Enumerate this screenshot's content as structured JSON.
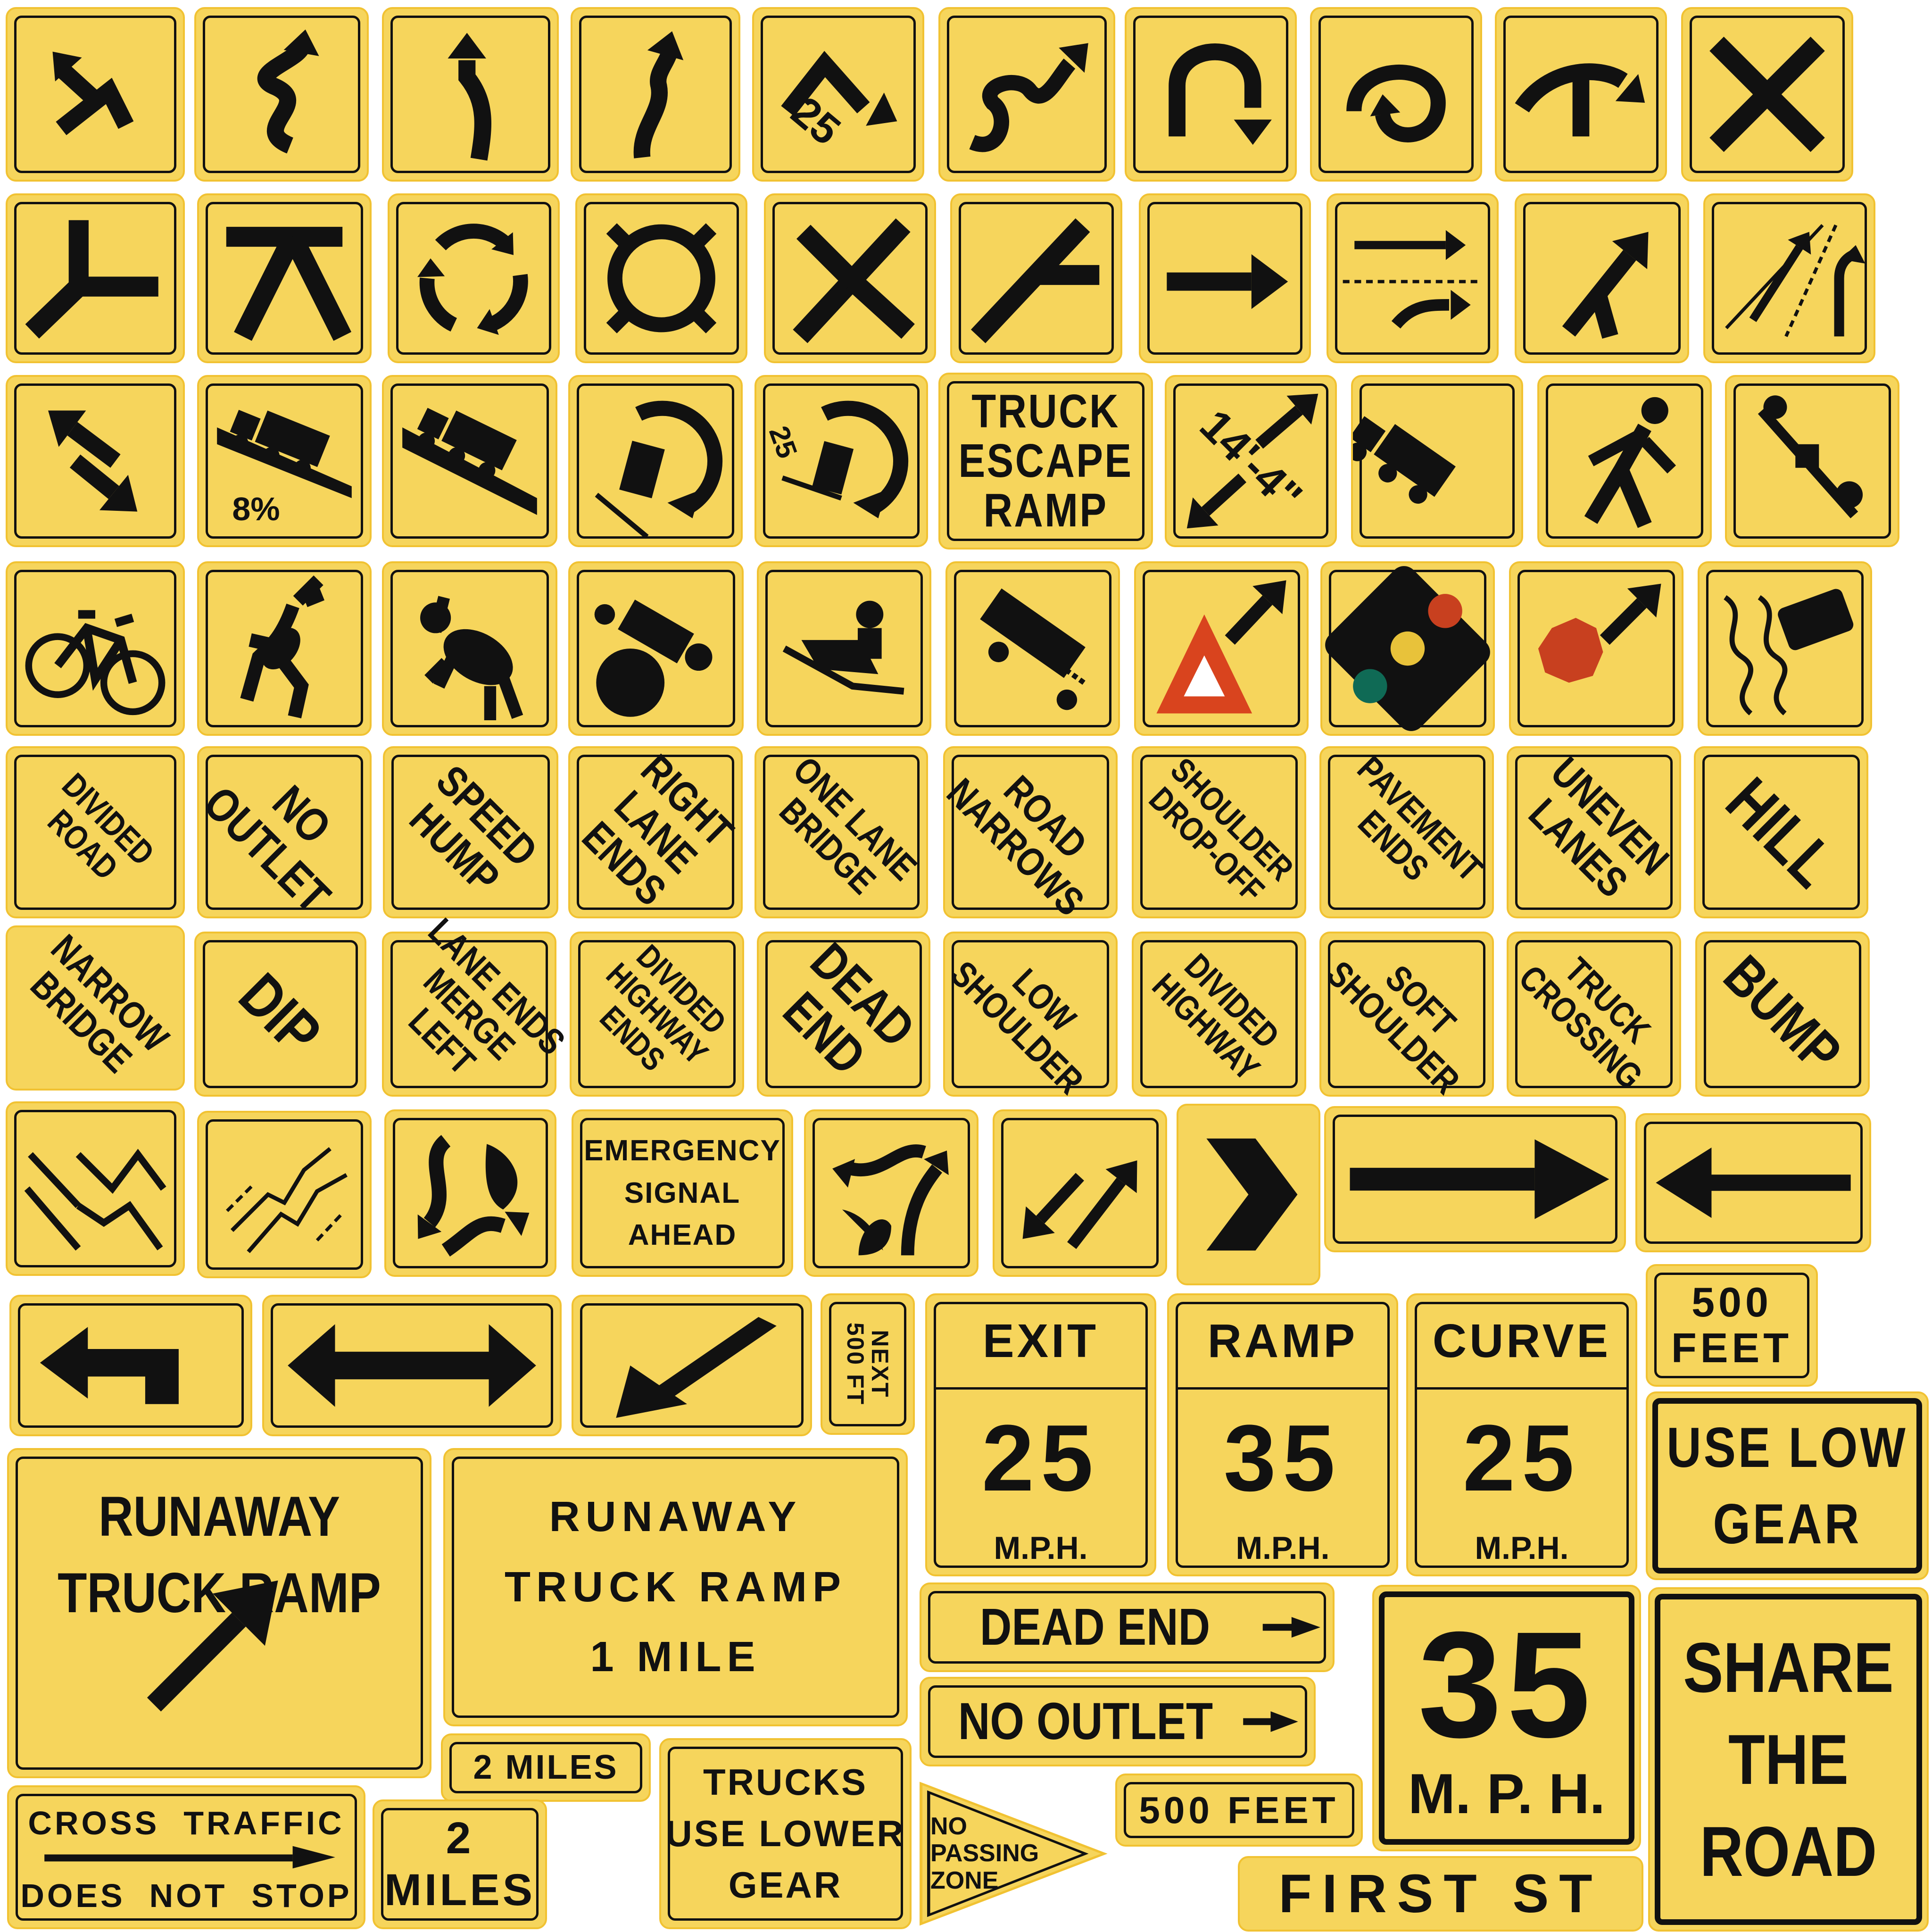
{
  "colors": {
    "sign_yellow": "#f6d55c",
    "legend_black": "#111111",
    "yield_red": "#d9441e",
    "stop_red": "#c8401f",
    "signal_red": "#c8401f",
    "signal_yellow": "#e8c23a",
    "signal_green": "#0f6a55"
  },
  "row1_icons": [
    "turn-right-icon",
    "winding-road-icon",
    "curve-left-icon",
    "reverse-curve-icon",
    "turn-advisory-25-icon",
    "winding-road-arrow-icon",
    "u-turn-icon",
    "loop-circle-icon",
    "side-road-right-icon",
    "cross-road-icon"
  ],
  "row1_texts": {
    "advisory": "25"
  },
  "row2_icons": [
    "y-intersection-icon",
    "t-intersection-icon",
    "roundabout-icon",
    "circle-intersection-icon",
    "side-road-left-icon",
    "merge-left-icon",
    "arrow-right-icon",
    "lane-shift-icon",
    "merge-up-icon",
    "added-lane-icon"
  ],
  "row3": {
    "grade": "8%",
    "curve_advisory": "25",
    "escape": [
      "TRUCK",
      "ESCAPE",
      "RAMP"
    ],
    "clearance": "14'-4\"",
    "icons": [
      "two-way-traffic-icon",
      "hill-grade-icon",
      "steep-hill-icon",
      "truck-rollover-icon",
      "truck-rollover-advisory-icon",
      "truck-escape-ramp-icon",
      "low-clearance-icon",
      "truck-crossing-icon",
      "pedestrian-icon",
      "playground-icon"
    ]
  },
  "row4_icons": [
    "bicycle-icon",
    "deer-icon",
    "cow-icon",
    "tractor-icon",
    "snowmobile-icon",
    "fire-truck-icon",
    "yield-ahead-icon",
    "signal-ahead-icon",
    "stop-ahead-icon",
    "slippery-road-icon"
  ],
  "row5": [
    "DIVIDED\nROAD",
    "NO\nOUTLET",
    "SPEED\nHUMP",
    "RIGHT\nLANE\nENDS",
    "ONE LANE\nBRIDGE",
    "ROAD\nNARROWS",
    "SHOULDER\nDROP-OFF",
    "PAVEMENT\nENDS",
    "UNEVEN\nLANES",
    "HILL"
  ],
  "row6": [
    "NARROW\nBRIDGE",
    "DIP",
    "LANE ENDS\nMERGE\nLEFT",
    "DIVIDED\nHIGHWAY\nENDS",
    "DEAD\nEND",
    "LOW\nSHOULDER",
    "DIVIDED\nHIGHWAY",
    "SOFT\nSHOULDER",
    "TRUCK\nCROSSING",
    "BUMP"
  ],
  "row7": {
    "emergency": [
      "EMERGENCY",
      "SIGNAL",
      "AHEAD"
    ],
    "icons": [
      "lane-shift-right-icon",
      "cracked-lanes-icon",
      "divided-split-icon",
      "merge-curve-icon",
      "two-way-diagonal-icon",
      "chevron-right-icon",
      "large-arrow-right-icon",
      "arrow-left-icon"
    ]
  },
  "row8": {
    "next": [
      "NEXT",
      "500 FT"
    ],
    "exit": {
      "title": "EXIT",
      "speed": "25",
      "unit": "M.P.H."
    },
    "ramp": {
      "title": "RAMP",
      "speed": "35",
      "unit": "M.P.H."
    },
    "curve": {
      "title": "CURVE",
      "speed": "25",
      "unit": "M.P.H."
    },
    "feet": [
      "500",
      "FEET"
    ],
    "gear": [
      "USE LOW",
      "GEAR"
    ],
    "icons": [
      "turn-left-arrow-icon",
      "double-arrow-icon",
      "arrow-down-left-icon"
    ]
  },
  "bottom": {
    "runaway1": [
      "RUNAWAY",
      "TRUCK RAMP"
    ],
    "runaway2": [
      "RUNAWAY",
      "TRUCK RAMP",
      "1 MILE"
    ],
    "dead_end": "DEAD END",
    "no_outlet": "NO OUTLET",
    "speed": {
      "value": "35",
      "unit": "M. P. H."
    },
    "share": [
      "SHARE",
      "THE",
      "ROAD"
    ],
    "two_miles": "2 MILES",
    "cross_top": "CROSS  TRAFFIC",
    "cross_bottom": "DOES  NOT  STOP",
    "two": [
      "2",
      "MILES"
    ],
    "trucks": [
      "TRUCKS",
      "USE LOWER",
      "GEAR"
    ],
    "no_passing": [
      "NO",
      "PASSING",
      "ZONE"
    ],
    "feet500": "500 FEET",
    "first": "FIRST ST"
  }
}
